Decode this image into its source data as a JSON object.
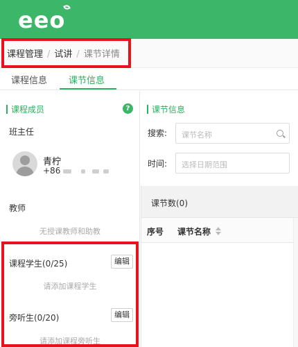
{
  "header": {
    "logo_text": "eeo"
  },
  "breadcrumb": {
    "items": [
      "课程管理",
      "试讲",
      "课节详情"
    ],
    "separator": "/"
  },
  "tabs": [
    {
      "label": "课程信息",
      "active": false
    },
    {
      "label": "课节信息",
      "active": true
    }
  ],
  "left_panel": {
    "members_title": "课程成员",
    "help_icon": "?",
    "head_teacher_label": "班主任",
    "head_teacher": {
      "name": "青柠",
      "phone_prefix": "+86"
    },
    "teachers_label": "教师",
    "teachers_empty": "无授课教师和助教",
    "students_label": "课程学生(0/25)",
    "students_edit": "编辑",
    "students_empty": "请添加课程学生",
    "auditors_label": "旁听生(0/20)",
    "auditors_edit": "编辑",
    "auditors_empty": "请添加课程旁听生"
  },
  "right_panel": {
    "title": "课节信息",
    "search_label": "搜索:",
    "search_placeholder": "课节名称",
    "time_label": "时间:",
    "time_placeholder": "选择日期范围",
    "list_title": "课节数(0)",
    "columns": [
      "序号",
      "课节名称"
    ]
  },
  "colors": {
    "brand_green": "#3cb769",
    "highlight_red": "#e6131f"
  }
}
